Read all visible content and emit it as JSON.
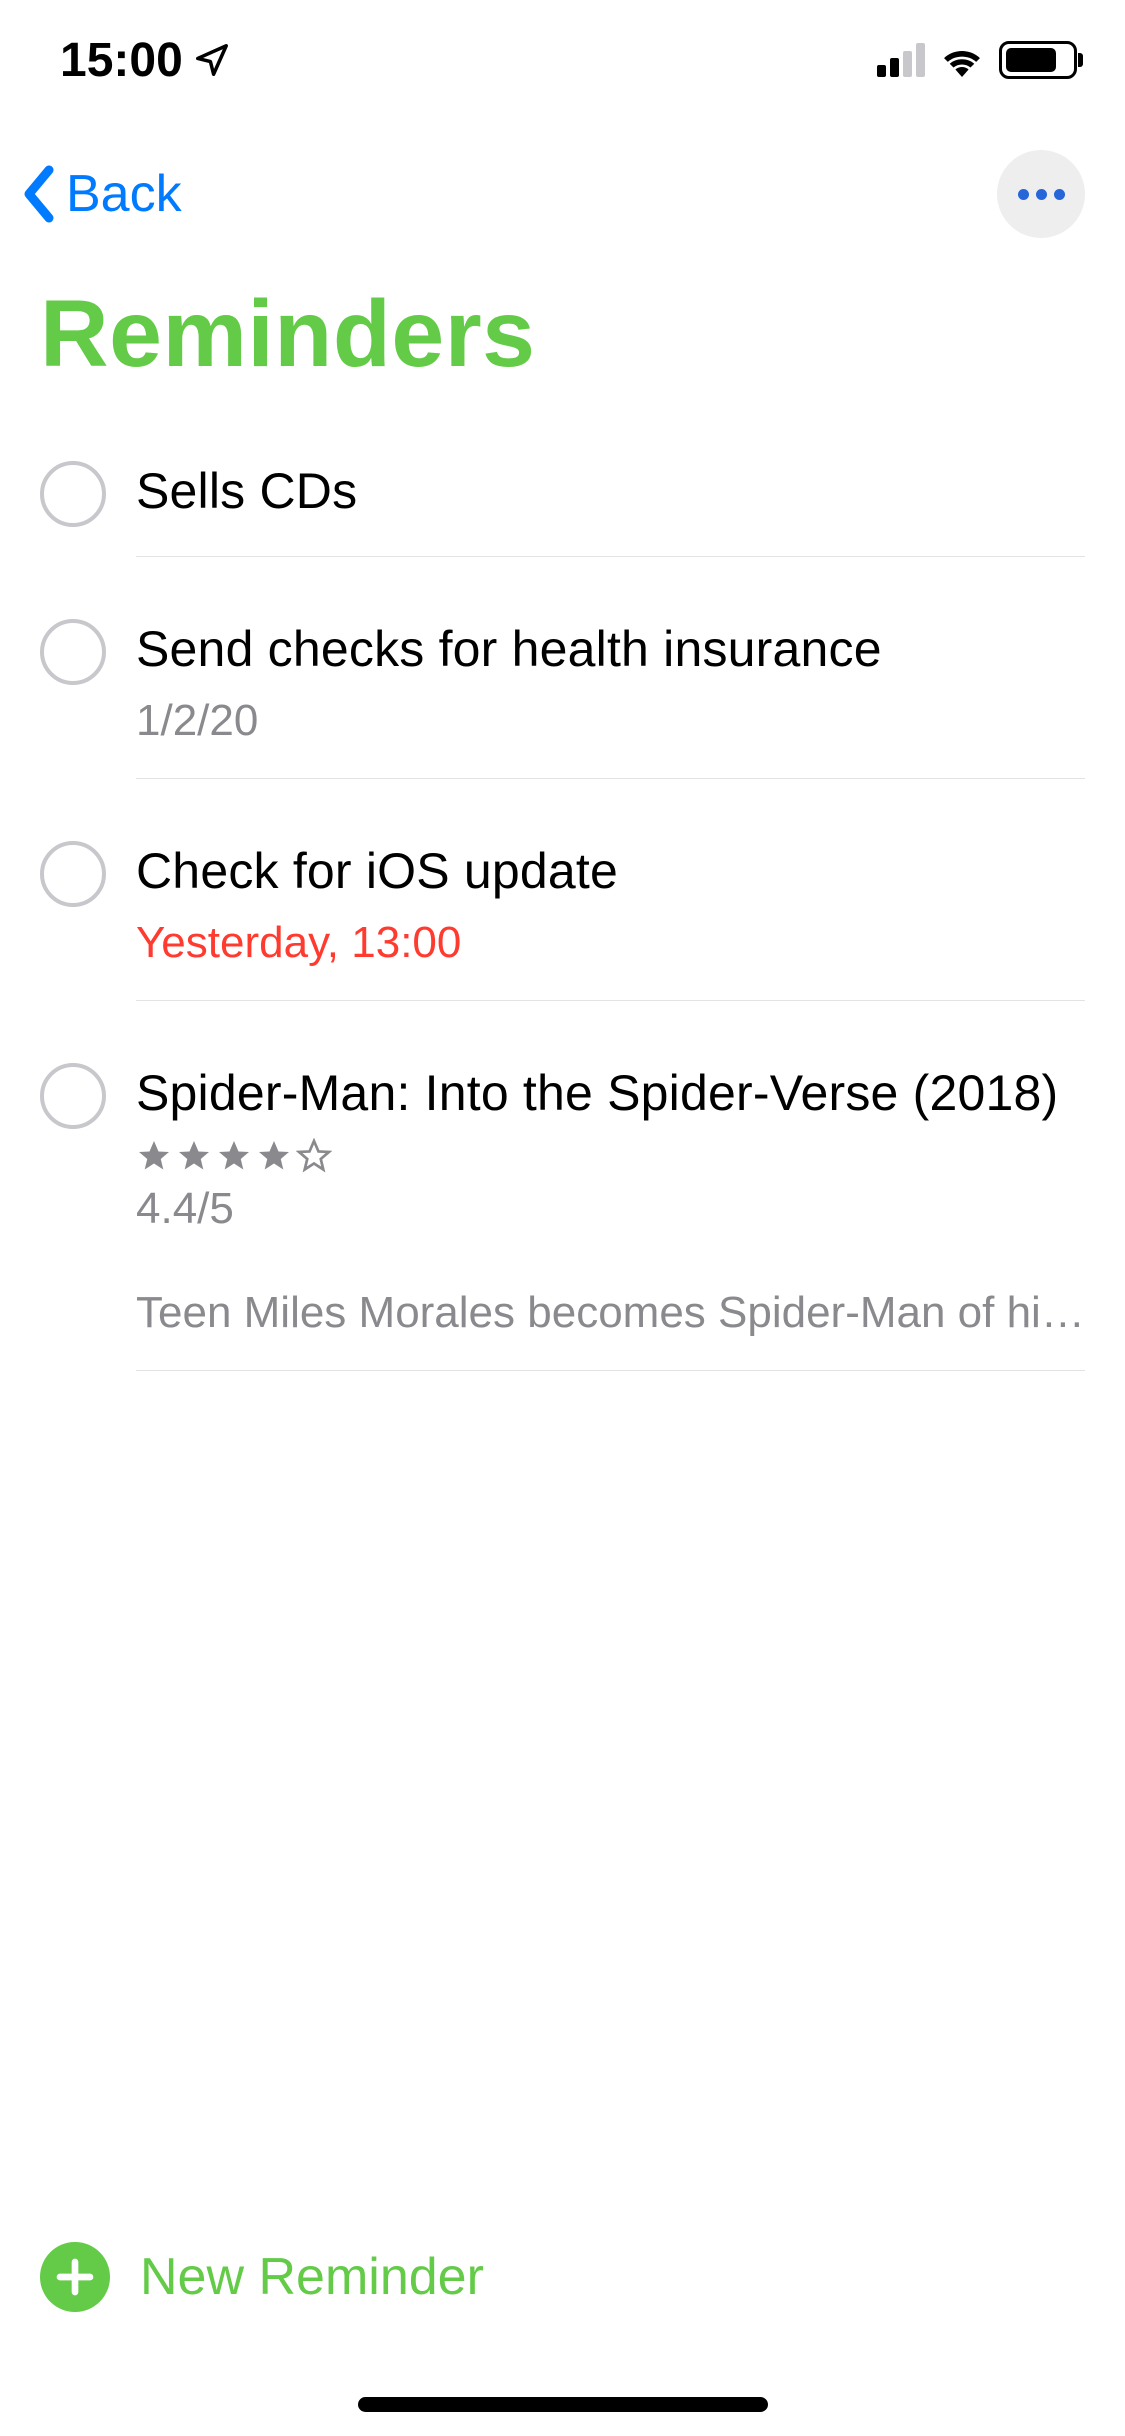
{
  "statusBar": {
    "time": "15:00"
  },
  "nav": {
    "backLabel": "Back"
  },
  "title": "Reminders",
  "reminders": [
    {
      "title": "Sells CDs",
      "date": "",
      "overdue": false
    },
    {
      "title": "Send checks for health insurance",
      "date": "1/2/20",
      "overdue": false
    },
    {
      "title": "Check for iOS update",
      "date": "Yesterday, 13:00",
      "overdue": true
    },
    {
      "title": "Spider-Man: Into the Spider-Verse (2018)",
      "stars": 4,
      "rating": "4.4/5",
      "description": "Teen Miles Morales becomes Spider-Man of his reality..."
    }
  ],
  "newReminder": {
    "label": "New Reminder"
  },
  "colors": {
    "accent": "#63CB47",
    "systemBlue": "#007AFF",
    "overdue": "#ff3b30"
  }
}
